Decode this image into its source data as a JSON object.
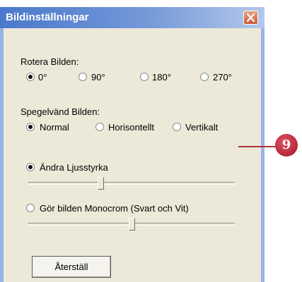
{
  "window": {
    "title": "Bildinställningar"
  },
  "rotate": {
    "label": "Rotera Bilden:",
    "options": [
      "0°",
      "90°",
      "180°",
      "270°"
    ],
    "selected_index": 0
  },
  "mirror": {
    "label": "Spegelvänd Bilden:",
    "options": [
      "Normal",
      "Horisontellt",
      "Vertikalt"
    ],
    "selected_index": 0
  },
  "brightness": {
    "label": "Ändra Ljusstyrka",
    "selected": true,
    "slider_fraction": 0.35
  },
  "monochrome": {
    "label": "Gör bilden Monocrom (Svart och Vit)",
    "selected": false,
    "slider_fraction": 0.5
  },
  "buttons": {
    "reset_label": "Återställ"
  },
  "callout": {
    "number": "9"
  }
}
